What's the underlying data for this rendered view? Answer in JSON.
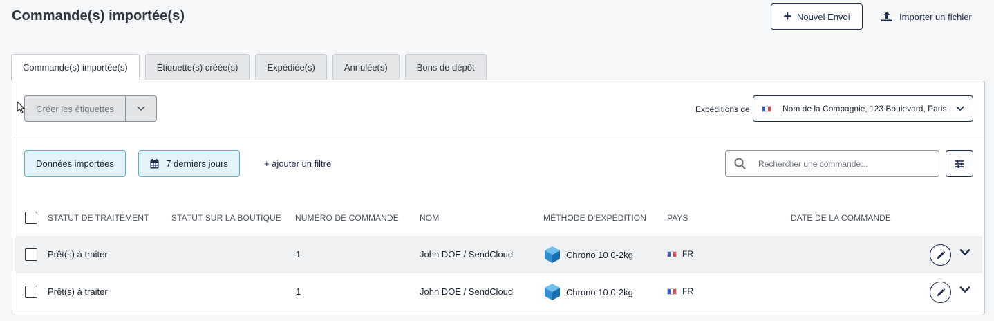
{
  "page": {
    "title": "Commande(s) importée(s)"
  },
  "header": {
    "new_label": "Nouvel Envoi",
    "import_label": "Importer un fichier"
  },
  "tabs": [
    {
      "label": "Commande(s) importée(s)",
      "active": true
    },
    {
      "label": "Étiquette(s) créée(s)",
      "active": false
    },
    {
      "label": "Expédiée(s)",
      "active": false
    },
    {
      "label": "Annulée(s)",
      "active": false
    },
    {
      "label": "Bons de dépôt",
      "active": false
    }
  ],
  "actions": {
    "create_labels": "Créer les étiquettes"
  },
  "expeditions": {
    "label": "Expéditions de",
    "value": "Nom de la Compagnie, 123 Boulevard, Paris"
  },
  "filters": {
    "data_chip": "Données importées",
    "date_chip": "7 derniers jours",
    "add_filter": "+ ajouter un filtre"
  },
  "search": {
    "placeholder": "Rechercher une commande..."
  },
  "table": {
    "columns": [
      "STATUT DE TRAITEMENT",
      "STATUT SUR LA BOUTIQUE",
      "NUMÉRO DE COMMANDE",
      "NOM",
      "MÉTHODE D'EXPÉDITION",
      "PAYS",
      "DATE DE LA COMMANDE"
    ],
    "rows": [
      {
        "status": "Prêt(s) à traiter",
        "shop_status": "",
        "order_no": "1",
        "name": "John DOE / SendCloud",
        "method": "Chrono 10 0-2kg",
        "country": "FR",
        "date": ""
      },
      {
        "status": "Prêt(s) à traiter",
        "shop_status": "",
        "order_no": "1",
        "name": "John DOE / SendCloud",
        "method": "Chrono 10 0-2kg",
        "country": "FR",
        "date": ""
      }
    ]
  },
  "colors": {
    "primary": "#1b2a4a",
    "chip_bg": "#e3f3fa",
    "chip_border": "#5bb0d6",
    "box_blue": "#2e8fd0"
  },
  "icons": {
    "new": "plus-icon",
    "import": "upload-icon",
    "calendar": "calendar-icon",
    "search": "search-icon",
    "settings": "sliders-icon",
    "edit": "pencil-icon",
    "expand": "chevron-down-icon",
    "carrier": "box-icon"
  }
}
